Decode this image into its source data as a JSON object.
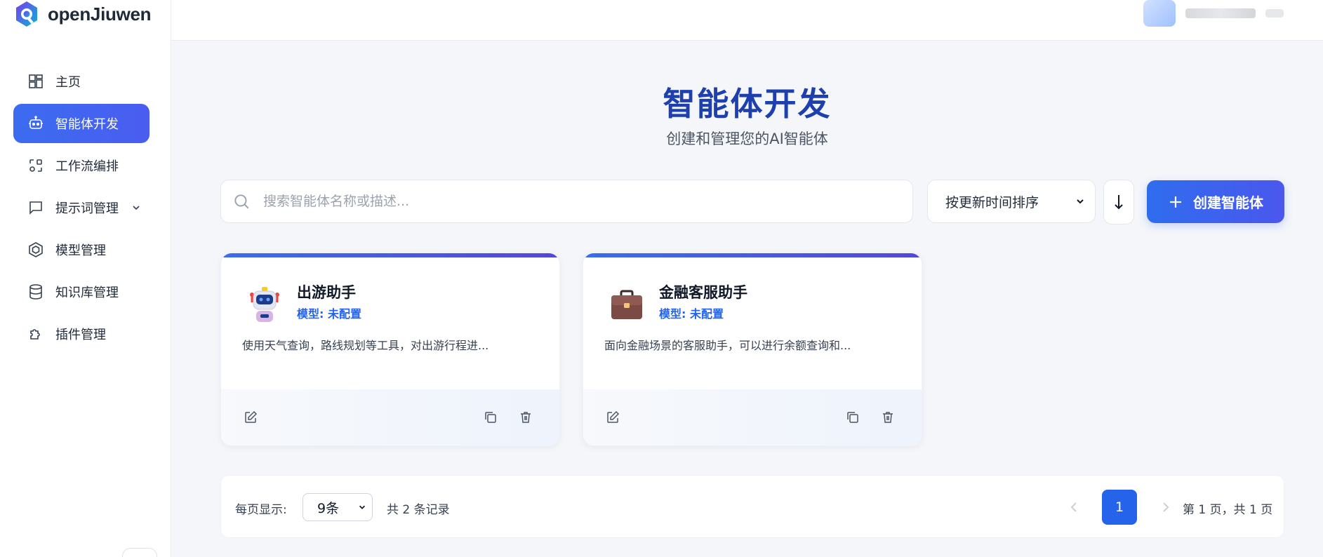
{
  "app": {
    "brand": "openJiuwen"
  },
  "sidebar": {
    "items": [
      {
        "label": "主页",
        "icon": "dashboard-icon"
      },
      {
        "label": "智能体开发",
        "icon": "robot-icon",
        "active": true
      },
      {
        "label": "工作流编排",
        "icon": "workflow-icon"
      },
      {
        "label": "提示词管理",
        "icon": "chat-icon",
        "expandable": true
      },
      {
        "label": "模型管理",
        "icon": "model-cube-icon"
      },
      {
        "label": "知识库管理",
        "icon": "database-icon"
      },
      {
        "label": "插件管理",
        "icon": "puzzle-icon"
      }
    ]
  },
  "main": {
    "title": "智能体开发",
    "subtitle": "创建和管理您的AI智能体",
    "search": {
      "placeholder": "搜索智能体名称或描述..."
    },
    "sort": {
      "selected": "按更新时间排序"
    },
    "sort_direction_icon": "arrow-down-icon",
    "create_button": "创建智能体",
    "cards": [
      {
        "name": "出游助手",
        "model": "模型: 未配置",
        "description": "使用天气查询，路线规划等工具，对出游行程进...",
        "icon": "robot-avatar-icon"
      },
      {
        "name": "金融客服助手",
        "model": "模型: 未配置",
        "description": "面向金融场景的客服助手，可以进行余额查询和...",
        "icon": "briefcase-icon"
      }
    ],
    "pagination": {
      "per_page_label": "每页显示:",
      "per_page_value": "9条",
      "total": "共 2 条记录",
      "current_page": "1",
      "page_info": "第 1 页，共 1 页"
    }
  },
  "colors": {
    "accent": "#2563eb",
    "title": "#1e40af",
    "gradient_start": "#3b6cf0",
    "gradient_end": "#5347e0"
  }
}
